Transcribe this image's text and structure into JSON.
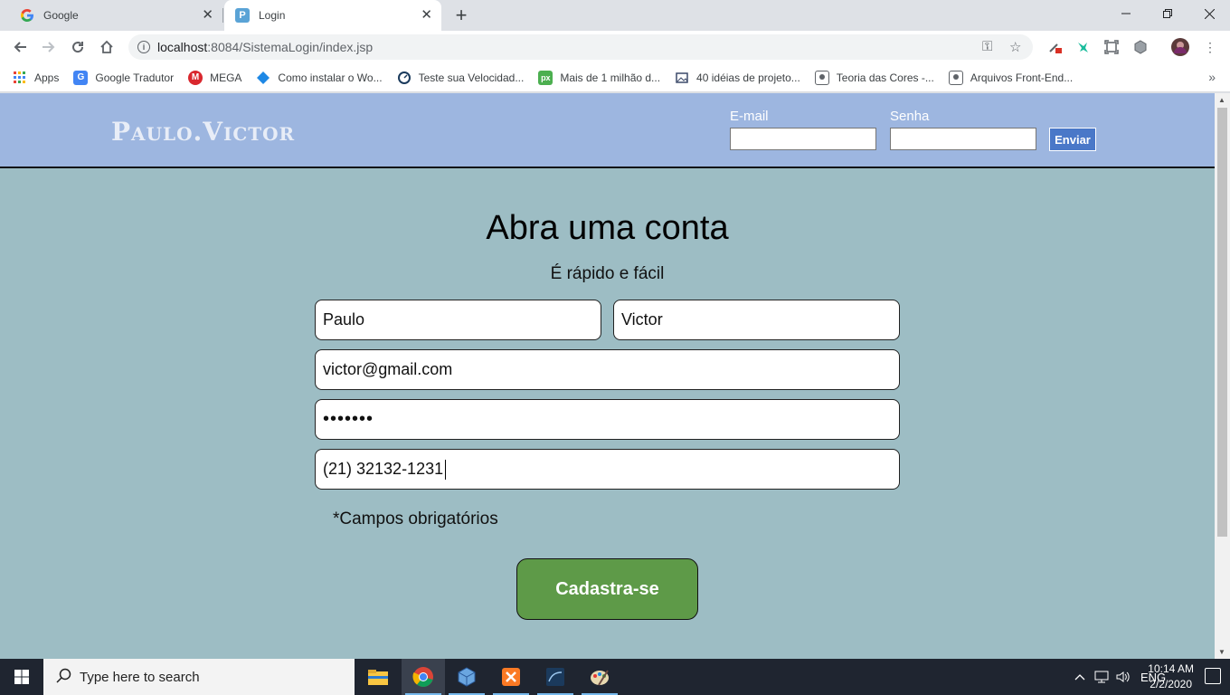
{
  "browser": {
    "tabs": [
      {
        "title": "Google",
        "icon": "google-icon",
        "active": false
      },
      {
        "title": "Login",
        "icon": "page-favicon-icon",
        "active": true
      }
    ],
    "url_host": "localhost",
    "url_path": ":8084/SistemaLogin/index.jsp",
    "bookmarks": [
      {
        "label": "Apps",
        "icon": "apps-grid-icon"
      },
      {
        "label": "Google Tradutor",
        "icon": "translate-icon"
      },
      {
        "label": "MEGA",
        "icon": "mega-icon"
      },
      {
        "label": "Como instalar o Wo...",
        "icon": "diamond-icon"
      },
      {
        "label": "Teste sua Velocidad...",
        "icon": "speedometer-icon"
      },
      {
        "label": "Mais de 1 milhão d...",
        "icon": "px-icon"
      },
      {
        "label": "40 idéias de projeto...",
        "icon": "image-icon"
      },
      {
        "label": "Teoria das Cores -...",
        "icon": "site-icon"
      },
      {
        "label": "Arquivos Front-End...",
        "icon": "site-icon"
      }
    ]
  },
  "site": {
    "logo": "Paulo.Victor",
    "login": {
      "email_label": "E-mail",
      "password_label": "Senha",
      "submit_label": "Enviar"
    }
  },
  "signup": {
    "title": "Abra uma conta",
    "subtitle": "É rápido e fácil",
    "first_name": "Paulo",
    "last_name": "Victor",
    "email": "victor@gmail.com",
    "password_mask": "•••••••",
    "phone": "(21) 32132-1231",
    "required_note": "*Campos obrigatórios",
    "submit_label": "Cadastra-se"
  },
  "taskbar": {
    "search_placeholder": "Type here to search",
    "language": "ENG",
    "time": "10:14 AM",
    "date": "2/2/2020"
  }
}
